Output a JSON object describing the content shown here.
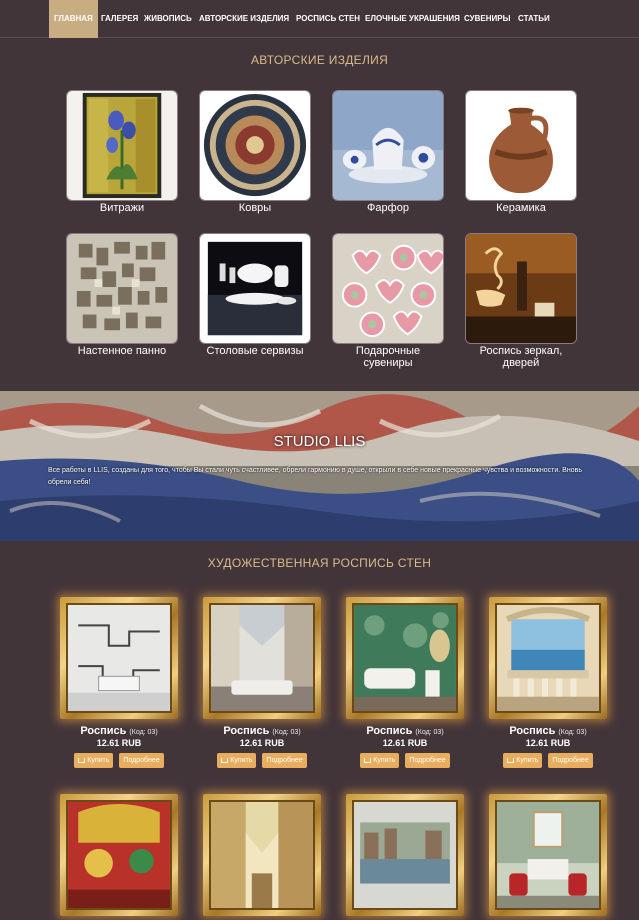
{
  "nav": {
    "items": [
      {
        "label": "Главная",
        "active": true
      },
      {
        "label": "Галерея"
      },
      {
        "label": "Живопись"
      },
      {
        "label": "Авторские изделия"
      },
      {
        "label": "Роспись стен"
      },
      {
        "label": "Елочные украшения"
      },
      {
        "label": "Сувениры"
      },
      {
        "label": "Статьи"
      }
    ]
  },
  "sections": {
    "crafts_title": "АВТОРСКИЕ ИЗДЕЛИЯ",
    "murals_title": "ХУДОЖЕСТВЕННАЯ РОСПИСЬ СТЕН"
  },
  "categories": [
    {
      "label": "Витражи",
      "icon": "stained-glass-image"
    },
    {
      "label": "Ковры",
      "icon": "carpet-image"
    },
    {
      "label": "Фарфор",
      "icon": "porcelain-image"
    },
    {
      "label": "Керамика",
      "icon": "ceramics-image"
    },
    {
      "label": "Настенное панно",
      "icon": "wall-panel-image"
    },
    {
      "label": "Столовые сервизы",
      "icon": "tableware-image"
    },
    {
      "label": "Подарочные сувениры",
      "icon": "gift-souvenirs-image"
    },
    {
      "label": "Роспись зеркал, дверей",
      "icon": "mirror-painting-image"
    }
  ],
  "banner": {
    "title": "STUDIO LLIS",
    "text": "Все работы в LLIS, созданы для того, чтобы Вы стали чуть счастливее, обрели гармонию в душе, открыли в себе новые прекрасные чувства и возможности. Вновь обрели себя!"
  },
  "products": [
    {
      "name": "Роспись",
      "code": "(Код: 03)",
      "price": "12.61 RUB",
      "buy": "Купить",
      "more": "Подробнее"
    },
    {
      "name": "Роспись",
      "code": "(Код: 03)",
      "price": "12.61 RUB",
      "buy": "Купить",
      "more": "Подробнее"
    },
    {
      "name": "Роспись",
      "code": "(Код: 03)",
      "price": "12.61 RUB",
      "buy": "Купить",
      "more": "Подробнее"
    },
    {
      "name": "Роспись",
      "code": "(Код: 03)",
      "price": "12.61 RUB",
      "buy": "Купить",
      "more": "Подробнее"
    },
    {
      "name": "",
      "code": "",
      "price": "",
      "buy": "",
      "more": ""
    },
    {
      "name": "",
      "code": "",
      "price": "",
      "buy": "",
      "more": ""
    },
    {
      "name": "",
      "code": "",
      "price": "",
      "buy": "",
      "more": ""
    },
    {
      "name": "",
      "code": "",
      "price": "",
      "buy": "",
      "more": ""
    }
  ],
  "colors": {
    "background": "#42353a",
    "accent": "#d9bb8c",
    "nav_active": "#c8ac82",
    "button": "#e8ae5e"
  }
}
